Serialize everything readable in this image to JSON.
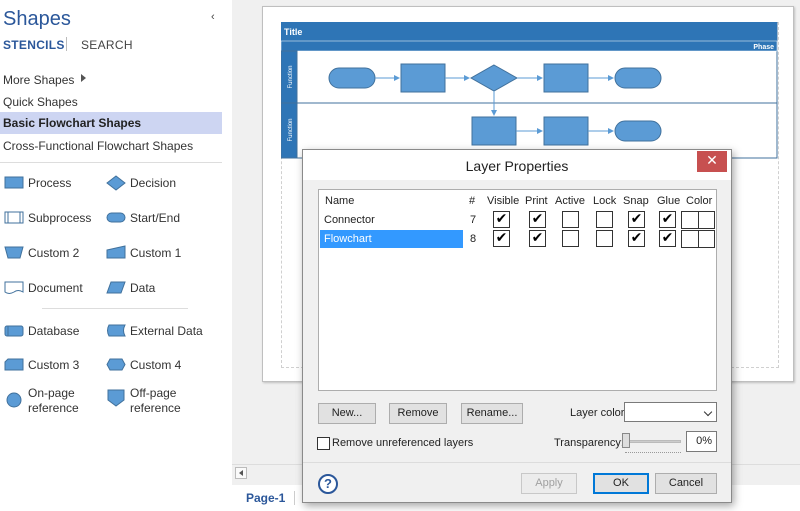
{
  "shapes_pane": {
    "title": "Shapes",
    "tabs": [
      "STENCILS",
      "SEARCH"
    ],
    "links": [
      {
        "id": "more-shapes",
        "label": "More Shapes"
      },
      {
        "id": "quick-shapes",
        "label": "Quick Shapes"
      },
      {
        "id": "basic-flowchart",
        "label": "Basic Flowchart Shapes",
        "selected": true
      },
      {
        "id": "cross-functional",
        "label": "Cross-Functional Flowchart Shapes"
      }
    ],
    "shapes": [
      {
        "label": "Process",
        "icon": "process-icon"
      },
      {
        "label": "Decision",
        "icon": "decision-icon"
      },
      {
        "label": "Subprocess",
        "icon": "subprocess-icon"
      },
      {
        "label": "Start/End",
        "icon": "start-end-icon"
      },
      {
        "label": "Custom 2",
        "icon": "custom-2-icon"
      },
      {
        "label": "Custom 1",
        "icon": "custom-1-icon"
      },
      {
        "label": "Document",
        "icon": "document-icon"
      },
      {
        "label": "Data",
        "icon": "data-icon"
      },
      {
        "label": "Database",
        "icon": "database-icon"
      },
      {
        "label": "External Data",
        "icon": "external-data-icon"
      },
      {
        "label": "Custom 3",
        "icon": "custom-3-icon"
      },
      {
        "label": "Custom 4",
        "icon": "custom-4-icon"
      },
      {
        "label": "On-page reference",
        "icon": "on-page-reference-icon"
      },
      {
        "label": "Off-page reference",
        "icon": "off-page-reference-icon"
      }
    ]
  },
  "diagram": {
    "title": "Title",
    "phase": "Phase",
    "lanes": [
      "Function",
      "Function"
    ]
  },
  "page_tabs": {
    "active": "Page-1"
  },
  "dialog": {
    "title": "Layer Properties",
    "close_label": "✕",
    "columns": [
      "Name",
      "#",
      "Visible",
      "Print",
      "Active",
      "Lock",
      "Snap",
      "Glue",
      "Color"
    ],
    "layers": [
      {
        "name": "Connector",
        "number": "7",
        "visible": true,
        "print": true,
        "active": false,
        "lock": false,
        "snap": true,
        "glue": true,
        "selected": false
      },
      {
        "name": "Flowchart",
        "number": "8",
        "visible": true,
        "print": true,
        "active": false,
        "lock": false,
        "snap": true,
        "glue": true,
        "selected": true
      }
    ],
    "buttons": {
      "new": "New...",
      "remove": "Remove",
      "rename": "Rename...",
      "apply": "Apply",
      "ok": "OK",
      "cancel": "Cancel"
    },
    "layer_color_label": "Layer color:",
    "layer_color_value": "",
    "remove_unreferenced_label": "Remove unreferenced layers",
    "remove_unreferenced_checked": false,
    "transparency_label": "Transparency:",
    "transparency_value": "0%",
    "help_label": "?"
  },
  "colors": {
    "accent": "#2b579a",
    "shape_fill": "#5b9bd5",
    "shape_stroke": "#41719c",
    "selection": "#3399ff",
    "stencil_selected": "#cdd5f2"
  }
}
